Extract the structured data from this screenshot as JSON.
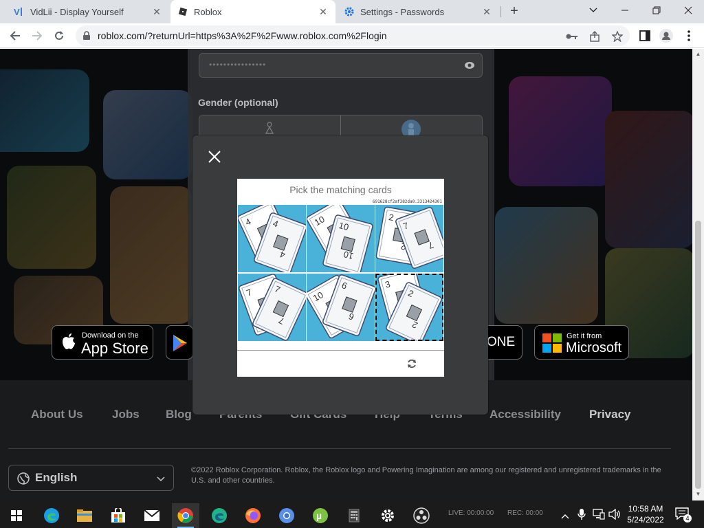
{
  "browser": {
    "tabs": [
      {
        "title": "VidLii - Display Yourself",
        "favicon": "vidlii-icon",
        "active": false
      },
      {
        "title": "Roblox",
        "favicon": "roblox-icon",
        "active": true
      },
      {
        "title": "Settings - Passwords",
        "favicon": "gear-icon",
        "active": false
      }
    ],
    "new_tab_label": "+",
    "url": "roblox.com/?returnUrl=https%3A%2F%2Fwww.roblox.com%2Flogin"
  },
  "signup": {
    "password_dots": "••••••••••••••••",
    "gender_label": "Gender (optional)"
  },
  "badges": {
    "app_store": {
      "small": "Download on the",
      "big": "App Store"
    },
    "xbox_partial": "ONE",
    "microsoft": {
      "small": "Get it from",
      "big": "Microsoft"
    }
  },
  "footer": {
    "links": [
      "About Us",
      "Jobs",
      "Blog",
      "Parents",
      "Gift Cards",
      "Help",
      "Terms",
      "Accessibility",
      "Privacy"
    ],
    "language": "English",
    "copyright": "©2022 Roblox Corporation. Roblox, the Roblox logo and Powering Imagination are among our registered and unregistered trademarks in the U.S. and other countries."
  },
  "captcha": {
    "prompt": "Pick the matching cards",
    "challenge_id": "691628cf2af382da0.3313424301",
    "cells": [
      {
        "cards": [
          "4",
          "4"
        ],
        "selected": false
      },
      {
        "cards": [
          "10",
          "10"
        ],
        "selected": false
      },
      {
        "cards": [
          "2",
          "7"
        ],
        "selected": false
      },
      {
        "cards": [
          "7",
          "7"
        ],
        "selected": false
      },
      {
        "cards": [
          "10",
          "6"
        ],
        "selected": false
      },
      {
        "cards": [
          "3",
          "2"
        ],
        "selected": true
      }
    ]
  },
  "taskbar": {
    "apps": [
      "start-icon",
      "edge-icon",
      "file-explorer-icon",
      "store-icon",
      "mail-icon",
      "chrome-icon",
      "edge-dev-icon",
      "firefox-icon",
      "chromium-icon",
      "utorrent-icon",
      "calculator-icon",
      "settings-icon",
      "obs-icon"
    ],
    "live_text": "LIVE: 00:00:00",
    "rec_text": "REC: 00:00",
    "time": "10:58 AM",
    "date": "5/24/2022",
    "notification_count": "4"
  },
  "colors": {
    "accent": "#1a73e8",
    "captcha_bg": "#4ab1d9",
    "page_bg": "#121416"
  }
}
